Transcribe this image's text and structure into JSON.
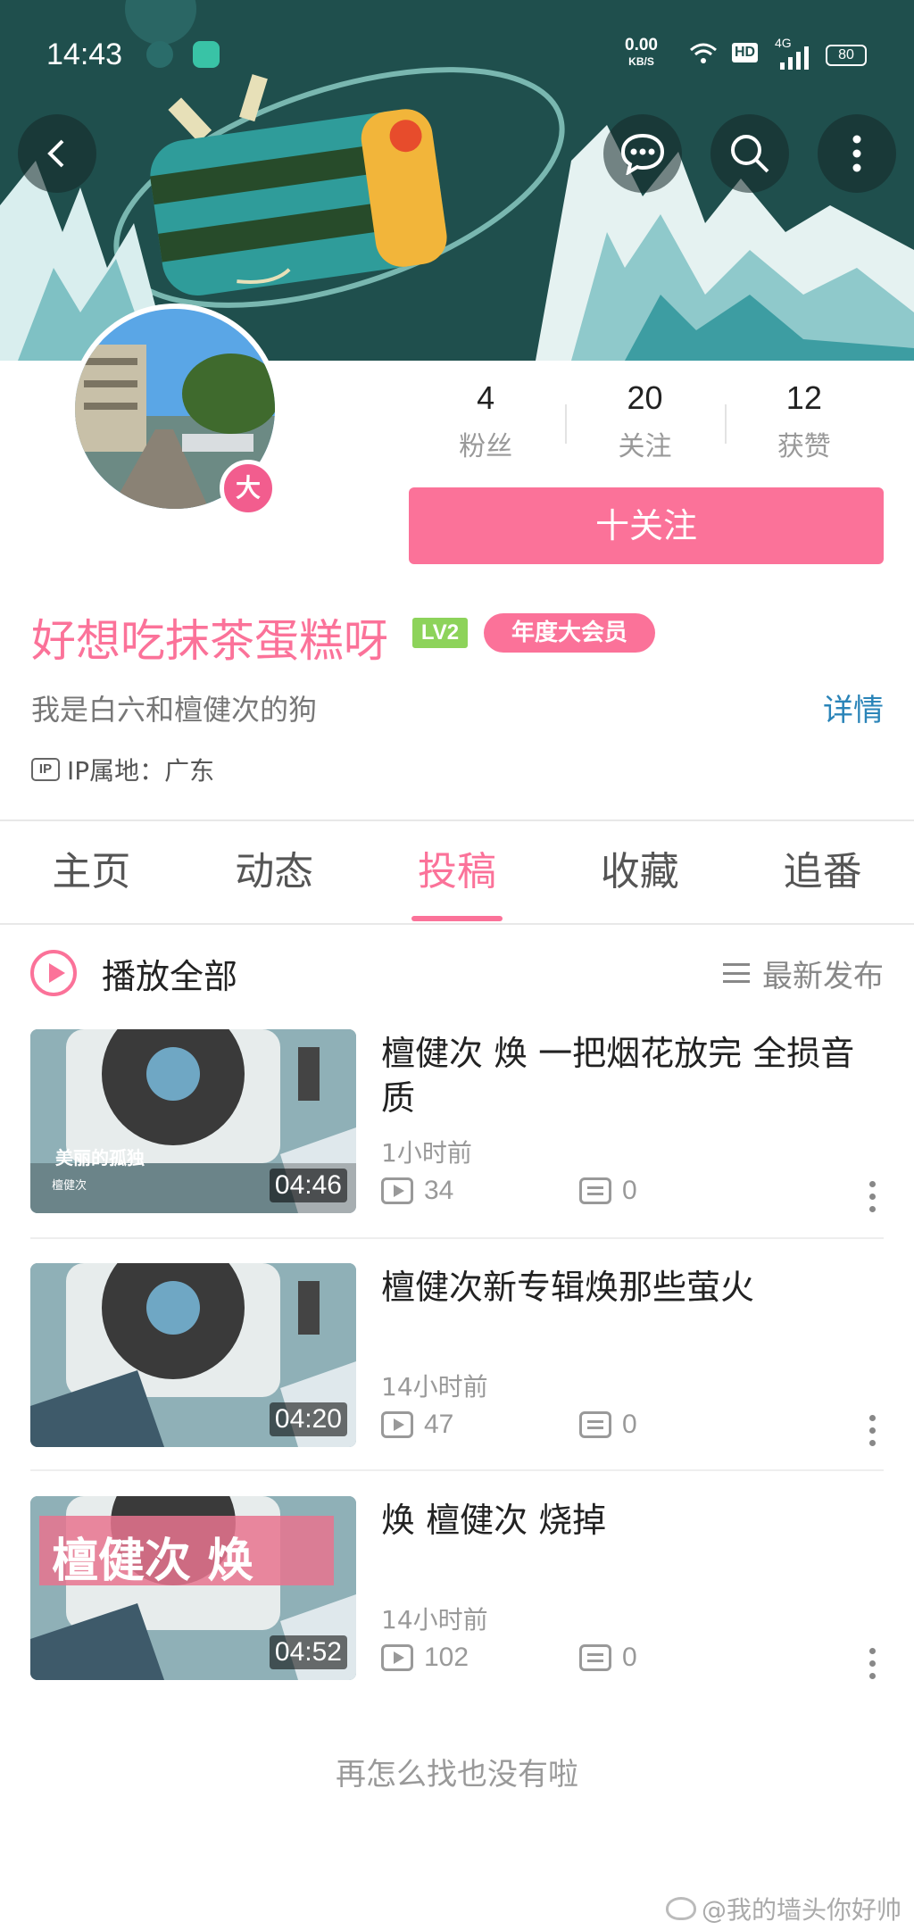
{
  "status_bar": {
    "time": "14:43",
    "net_speed": "0.00",
    "net_unit": "KB/S",
    "hd": "HD",
    "net_type": "4G",
    "battery": "80"
  },
  "header": {
    "back_icon": "back-arrow-icon",
    "message_icon": "chat-bubble-icon",
    "search_icon": "search-icon",
    "more_icon": "more-vertical-icon"
  },
  "profile": {
    "vip_badge": "大",
    "stats": [
      {
        "value": "4",
        "label": "粉丝"
      },
      {
        "value": "20",
        "label": "关注"
      },
      {
        "value": "12",
        "label": "获赞"
      }
    ],
    "follow_label": "十关注",
    "username": "好想吃抹茶蛋糕呀",
    "level": "LV2",
    "vip_tag": "年度大会员",
    "signature": "我是白六和檀健次的狗",
    "detail_link": "详情",
    "ip_badge": "IP",
    "ip_label": "IP属地：广东"
  },
  "tabs": [
    {
      "label": "主页",
      "active": false
    },
    {
      "label": "动态",
      "active": false
    },
    {
      "label": "投稿",
      "active": true
    },
    {
      "label": "收藏",
      "active": false
    },
    {
      "label": "追番",
      "active": false
    }
  ],
  "list_header": {
    "play_all": "播放全部",
    "sort": "最新发布"
  },
  "videos": [
    {
      "title": "檀健次  焕 一把烟花放完 全损音质",
      "time": "1小时前",
      "plays": "34",
      "comments": "0",
      "duration": "04:46",
      "thumb_caption": "美丽的孤独",
      "thumb_sub": "檀健次"
    },
    {
      "title": "檀健次新专辑焕那些萤火",
      "time": "14小时前",
      "plays": "47",
      "comments": "0",
      "duration": "04:20"
    },
    {
      "title": "焕 檀健次  烧掉",
      "time": "14小时前",
      "plays": "102",
      "comments": "0",
      "duration": "04:52",
      "thumb_caption": "檀健次 焕"
    }
  ],
  "end_text": "再怎么找也没有啦",
  "watermark": "@我的墙头你好帅",
  "colors": {
    "accent": "#fb7299",
    "link": "#2a84b8",
    "level": "#8dd35a"
  }
}
